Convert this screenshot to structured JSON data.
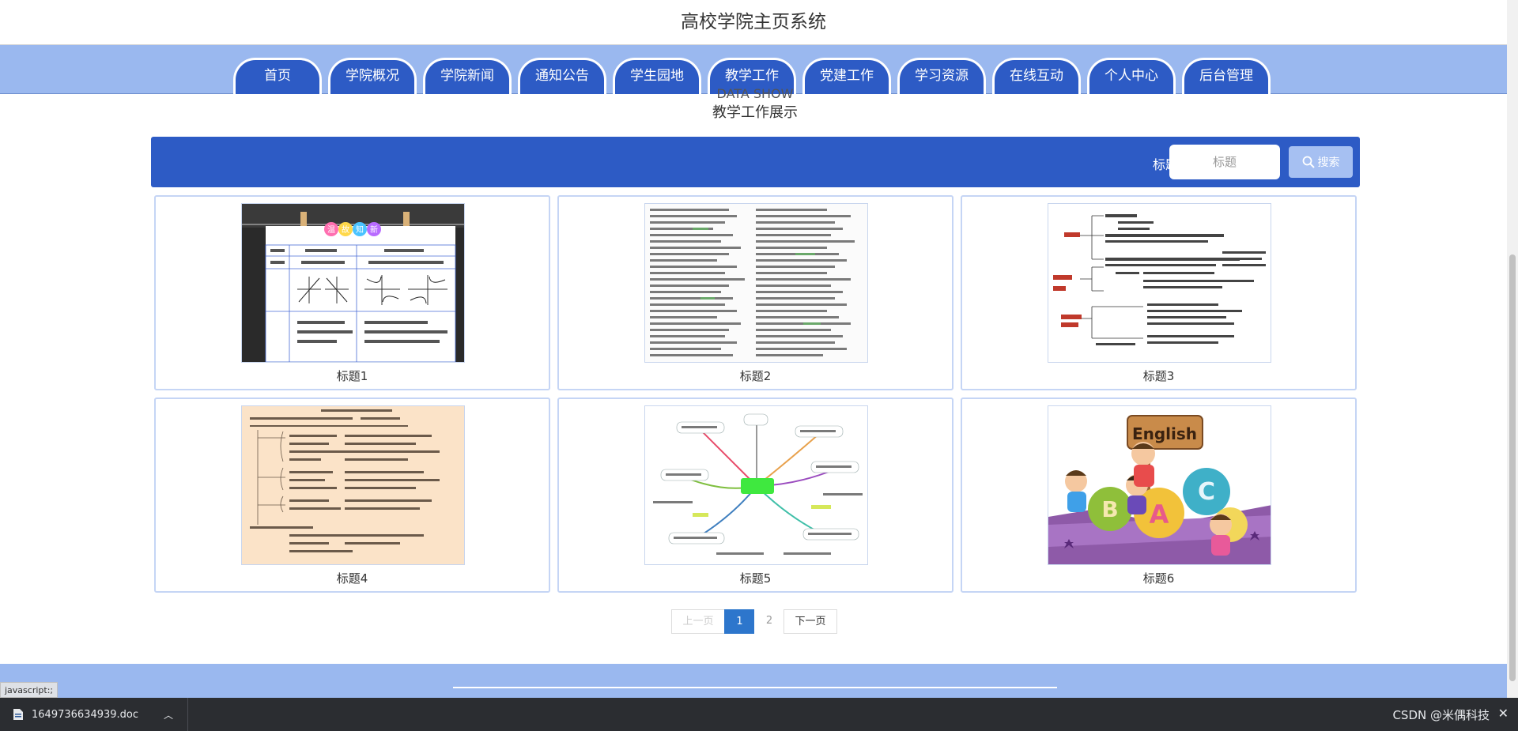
{
  "header": {
    "site_title": "高校学院主页系统"
  },
  "nav": {
    "items": [
      "首页",
      "学院概况",
      "学院新闻",
      "通知公告",
      "学生园地",
      "教学工作",
      "党建工作",
      "学习资源",
      "在线互动",
      "个人中心",
      "后台管理"
    ]
  },
  "section": {
    "title_en": "DATA SHOW",
    "title_cn": "教学工作展示"
  },
  "search": {
    "label": "标题",
    "placeholder": "标题",
    "button_label": "搜索"
  },
  "cards": [
    {
      "title": "标题1",
      "image": "math-functions-table"
    },
    {
      "title": "标题2",
      "image": "text-document"
    },
    {
      "title": "标题3",
      "image": "mind-map-text"
    },
    {
      "title": "标题4",
      "image": "outline-notes"
    },
    {
      "title": "标题5",
      "image": "colorful-mind-map"
    },
    {
      "title": "标题6",
      "image": "english-cartoon"
    }
  ],
  "thumb_text": {
    "banner_chars": [
      "温",
      "故",
      "知",
      "新"
    ],
    "english_sign": "English"
  },
  "pagination": {
    "prev_label": "上一页",
    "pages": [
      "1",
      "2"
    ],
    "current": "1",
    "next_label": "下一页"
  },
  "status_url": "javascript:;",
  "downloads": {
    "file_name": "1649736634939.doc"
  },
  "watermark": "CSDN @米偶科技",
  "colors": {
    "primary": "#2d5bc5",
    "nav_bg": "#9ab8ef",
    "active_page": "#2d76cc"
  }
}
